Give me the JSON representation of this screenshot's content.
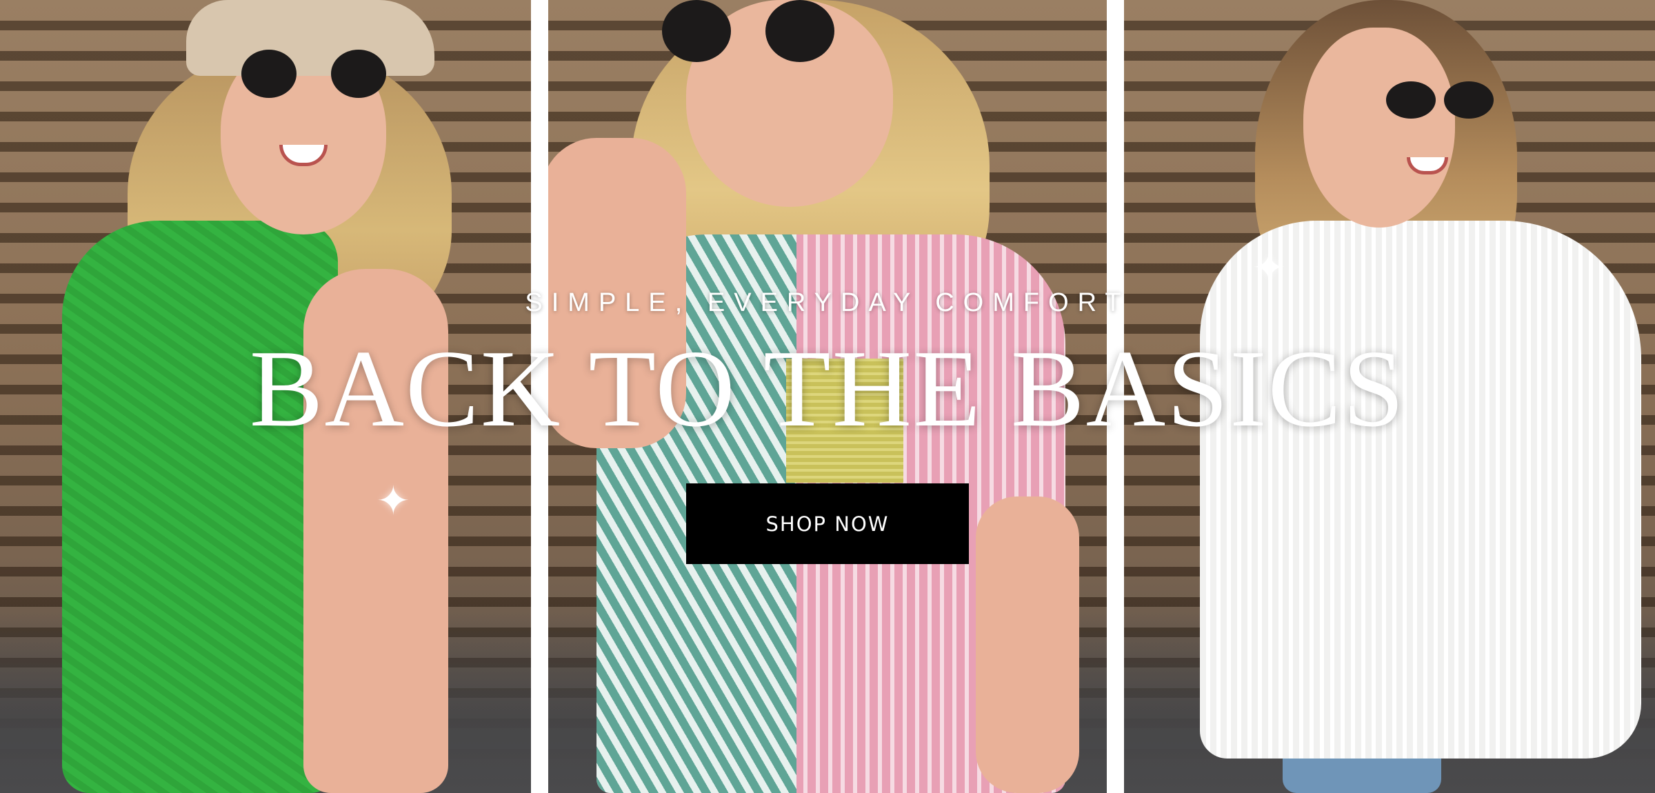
{
  "hero": {
    "subtitle": "SIMPLE, EVERYDAY COMFORT",
    "headline": "BACK TO THE BASICS",
    "cta_label": "SHOP NOW",
    "sparkle_icon": "✦"
  },
  "colors": {
    "cta_background": "#000000",
    "cta_text": "#ffffff",
    "overlay_text": "#ffffff",
    "divider": "#ffffff"
  }
}
